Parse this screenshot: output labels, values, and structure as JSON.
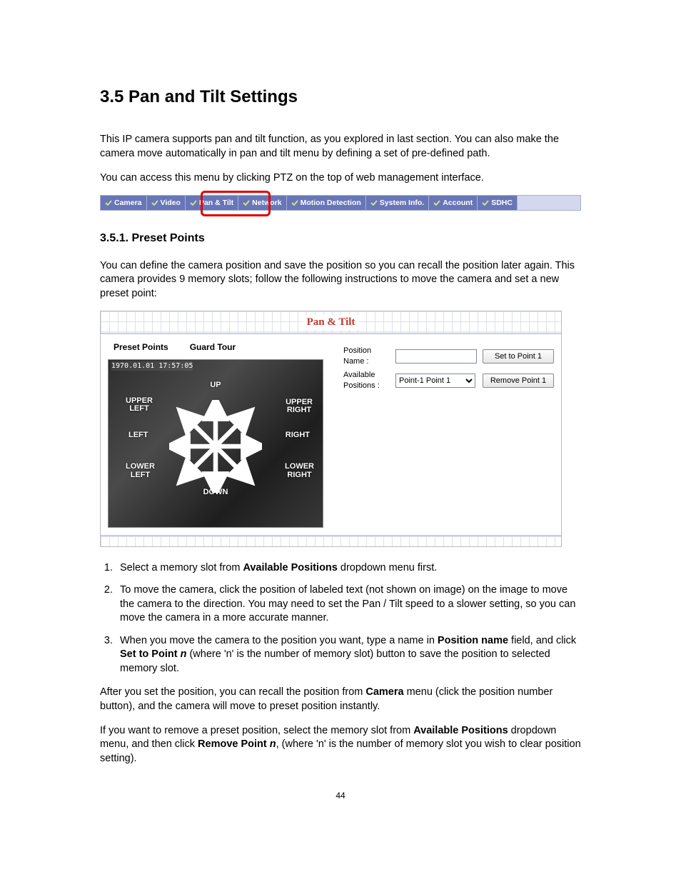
{
  "page_number": "44",
  "heading": "3.5   Pan and Tilt Settings",
  "intro_p1": "This IP camera supports pan and tilt function, as you explored in last section. You can also make the camera move automatically in pan and tilt menu by defining a set of pre-defined path.",
  "intro_p2": "You can access this menu by clicking PTZ on the top of web management interface.",
  "nav": {
    "items": [
      "Camera",
      "Video",
      "Pan & Tilt",
      "Network",
      "Motion Detection",
      "System Info.",
      "Account",
      "SDHC"
    ]
  },
  "sub_heading": "3.5.1.  Preset Points",
  "sub_p1": "You can define the camera position and save the position so you can recall the position later again. This camera provides 9 memory slots; follow the following instructions to move the camera and set a new preset point:",
  "pt": {
    "title": "Pan & Tilt",
    "tabs": {
      "preset": "Preset Points",
      "tour": "Guard Tour"
    },
    "timestamp": "1970.01.01 17:57:05",
    "dir": {
      "up": "UP",
      "down": "DOWN",
      "left": "LEFT",
      "right": "RIGHT",
      "ul1": "UPPER",
      "ul2": "LEFT",
      "ur1": "UPPER",
      "ur2": "RIGHT",
      "ll1": "LOWER",
      "ll2": "LEFT",
      "lr1": "LOWER",
      "lr2": "RIGHT"
    },
    "form": {
      "position_name_label": "Position Name :",
      "available_label": "Available Positions :",
      "dropdown_value": "Point-1  Point 1",
      "set_btn": "Set to Point 1",
      "remove_btn": "Remove Point 1"
    }
  },
  "steps": {
    "s1a": "Select a memory slot from ",
    "s1b": "Available Positions",
    "s1c": " dropdown menu first.",
    "s2": "To move the camera, click the position of labeled text (not shown on image) on the image to move the camera to the direction. You may need to set the Pan / Tilt speed to a slower setting, so you can move the camera in a more accurate manner.",
    "s3a": "When you move the camera to the position you want, type a name in ",
    "s3b": "Position name",
    "s3c": " field, and click ",
    "s3d": "Set to Point ",
    "s3e": "n",
    "s3f": " (where 'n' is the number of memory slot) button to save the position to selected memory slot."
  },
  "after_p1a": "After you set the position, you can recall the position from ",
  "after_p1b": "Camera",
  "after_p1c": " menu (click the position number button), and the camera will move to preset position instantly.",
  "after_p2a": "If you want to remove a preset position, select the memory slot from ",
  "after_p2b": "Available Positions",
  "after_p2c": " dropdown menu, and then click ",
  "after_p2d": "Remove Point ",
  "after_p2e": "n",
  "after_p2f": ", (where 'n' is the number of memory slot you wish to clear position setting)."
}
